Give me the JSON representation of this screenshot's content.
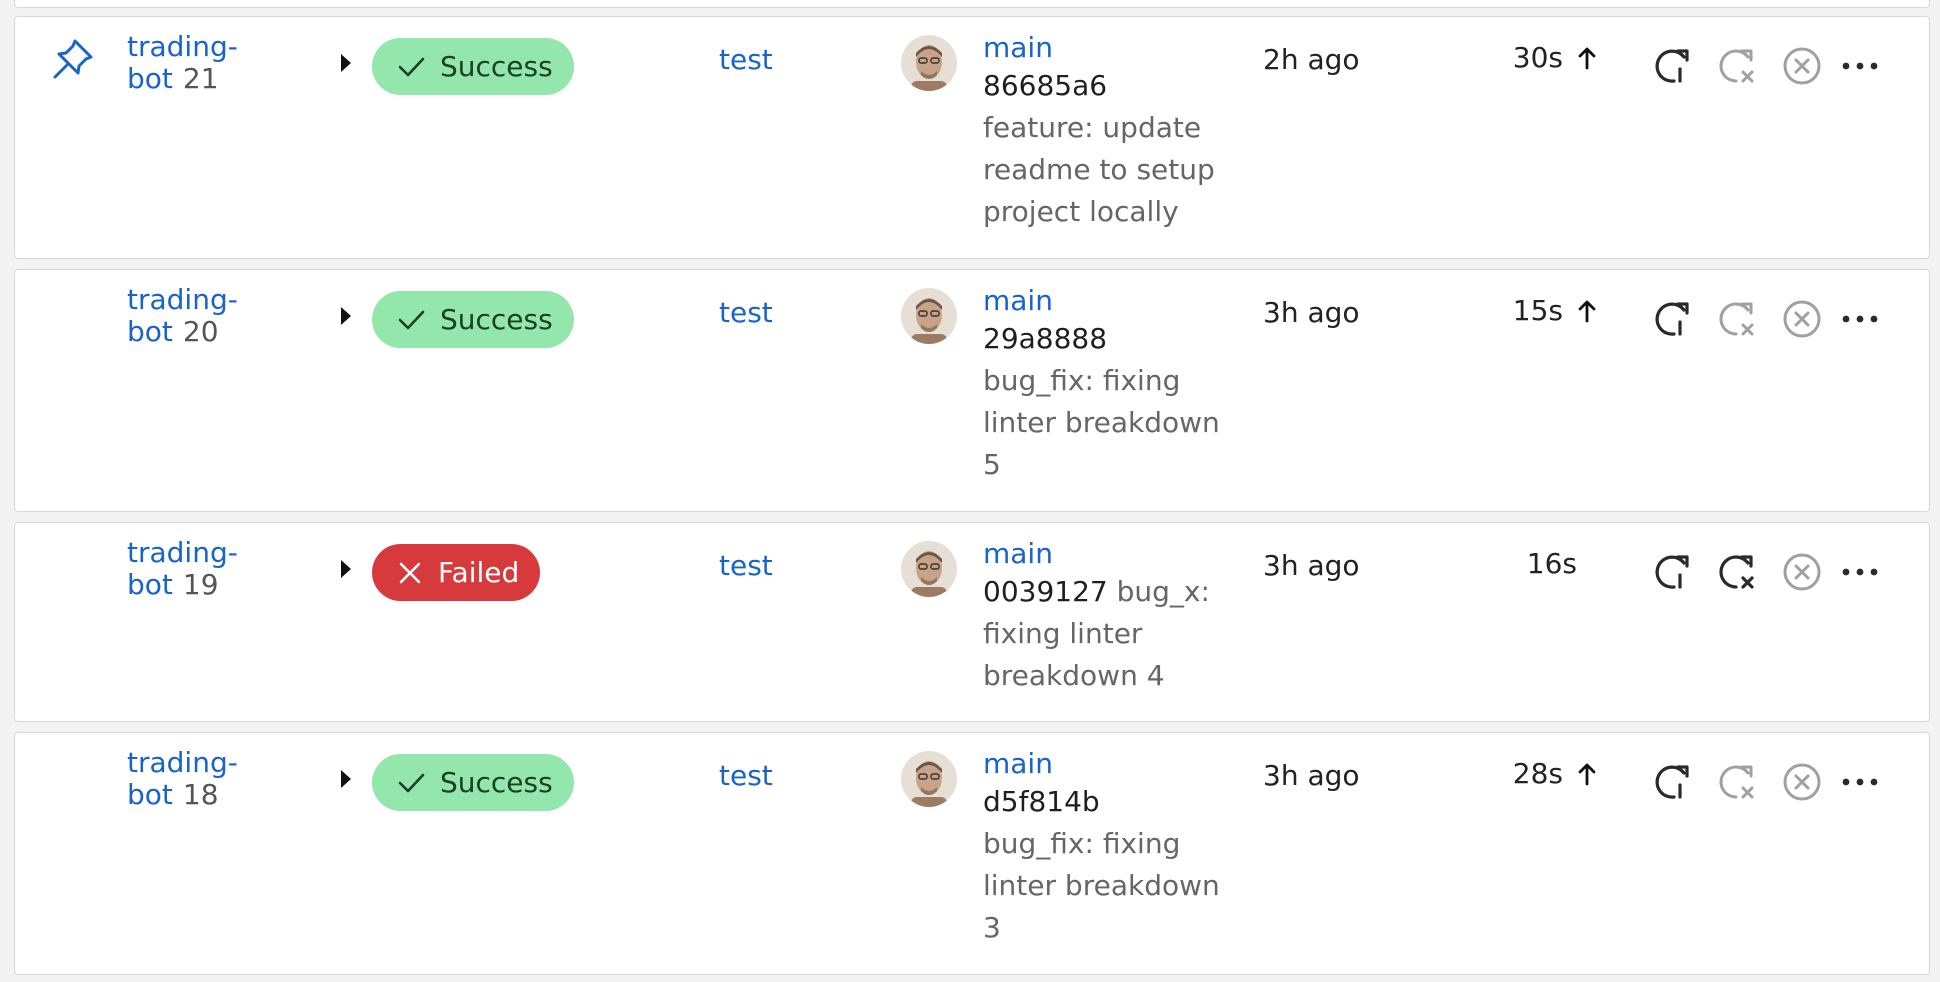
{
  "pipelines": [
    {
      "pinned": true,
      "project": "trading-bot",
      "project_line1": "trading-",
      "project_line2": "bot",
      "number": "21",
      "status": "Success",
      "status_kind": "success",
      "stage": "test",
      "branch": "main",
      "sha": "86685a6",
      "message": "feature: update readme to setup project locally",
      "time": "2h ago",
      "duration": "30s",
      "duration_arrow": true,
      "actions": [
        "rerun-icon",
        "rerun-failed-icon",
        "cancel-icon",
        "more-icon"
      ],
      "rerun_failed_enabled": false
    },
    {
      "pinned": false,
      "project": "trading-bot",
      "project_line1": "trading-",
      "project_line2": "bot",
      "number": "20",
      "status": "Success",
      "status_kind": "success",
      "stage": "test",
      "branch": "main",
      "sha": "29a8888",
      "message": "bug_fix: fixing linter breakdown 5",
      "time": "3h ago",
      "duration": "15s",
      "duration_arrow": true,
      "actions": [
        "rerun-icon",
        "rerun-failed-icon",
        "cancel-icon",
        "more-icon"
      ],
      "rerun_failed_enabled": false
    },
    {
      "pinned": false,
      "project": "trading-bot",
      "project_line1": "trading-",
      "project_line2": "bot",
      "number": "19",
      "status": "Failed",
      "status_kind": "failed",
      "stage": "test",
      "branch": "main",
      "sha": "0039127",
      "message": "bug_x: fixing linter breakdown 4",
      "time": "3h ago",
      "duration": "16s",
      "duration_arrow": false,
      "actions": [
        "rerun-icon",
        "rerun-failed-icon",
        "cancel-icon",
        "more-icon"
      ],
      "rerun_failed_enabled": true
    },
    {
      "pinned": false,
      "project": "trading-bot",
      "project_line1": "trading-",
      "project_line2": "bot",
      "number": "18",
      "status": "Success",
      "status_kind": "success",
      "stage": "test",
      "branch": "main",
      "sha": "d5f814b",
      "message": "bug_fix: fixing linter breakdown 3",
      "time": "3h ago",
      "duration": "28s",
      "duration_arrow": true,
      "actions": [
        "rerun-icon",
        "rerun-failed-icon",
        "cancel-icon",
        "more-icon"
      ],
      "rerun_failed_enabled": false
    }
  ],
  "colors": {
    "link": "#1a63c9",
    "success_bg": "#93e6ac",
    "failed_bg": "#d63a3c",
    "icon_dark": "#2a2a2a",
    "icon_muted": "#a0a0a0"
  }
}
